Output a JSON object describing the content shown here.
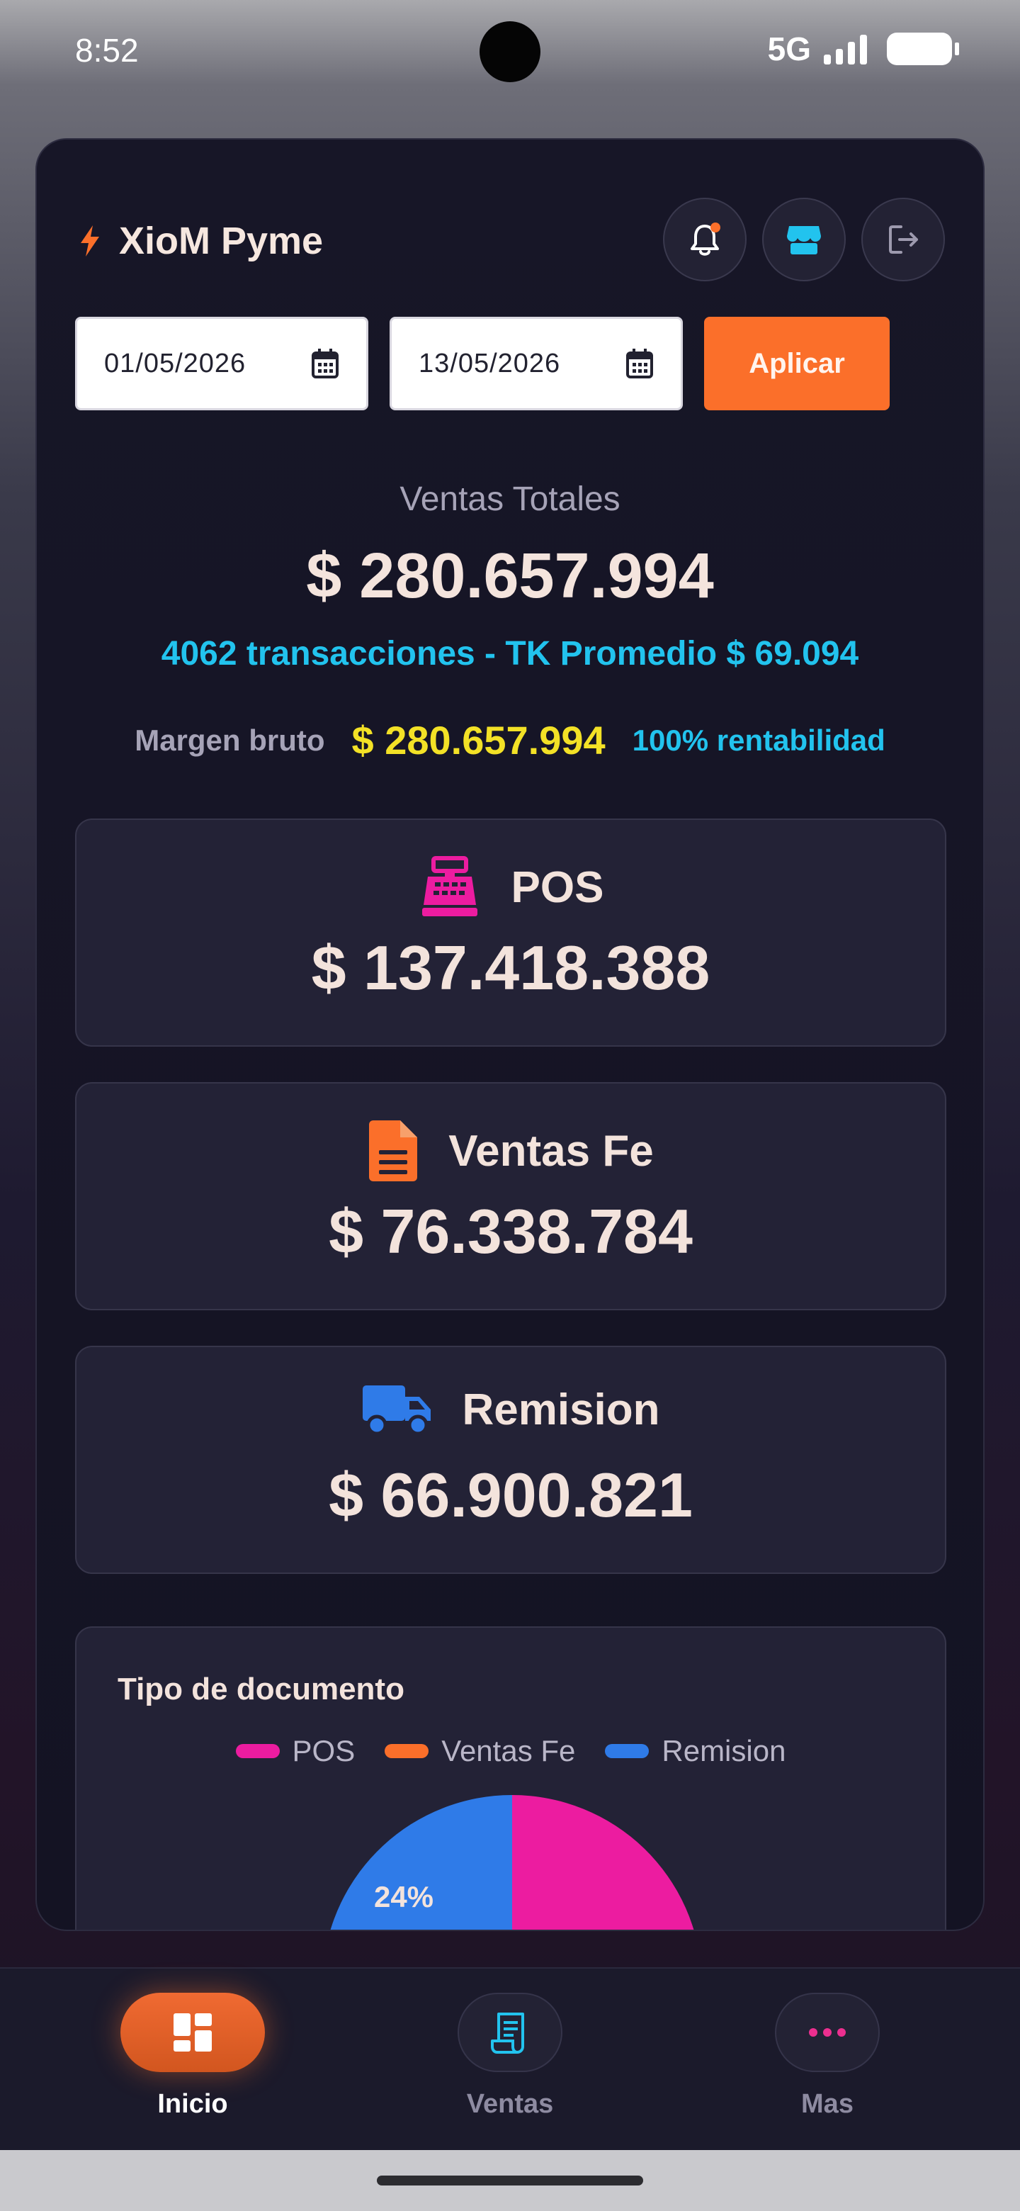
{
  "status": {
    "time": "8:52",
    "network": "5G"
  },
  "app": {
    "brand": "XioM Pyme"
  },
  "filters": {
    "date_from": "01/05/2026",
    "date_to": "13/05/2026",
    "apply_label": "Aplicar"
  },
  "totals": {
    "label": "Ventas Totales",
    "amount": "$ 280.657.994",
    "subtitle": "4062 transacciones - TK Promedio $ 69.094",
    "margin_label": "Margen bruto",
    "margin_amount": "$ 280.657.994",
    "margin_pct": "100% rentabilidad"
  },
  "kpis": [
    {
      "title": "POS",
      "amount": "$ 137.418.388",
      "icon": "cash-register-icon",
      "color": "#ec1ca0"
    },
    {
      "title": "Ventas Fe",
      "amount": "$ 76.338.784",
      "icon": "document-icon",
      "color": "#fb6f2a"
    },
    {
      "title": "Remision",
      "amount": "$ 66.900.821",
      "icon": "truck-icon",
      "color": "#2f7be8"
    }
  ],
  "chart_data": {
    "type": "pie",
    "title": "Tipo de documento",
    "categories": [
      "POS",
      "Ventas Fe",
      "Remision"
    ],
    "values": [
      137418388,
      76338784,
      66900821
    ],
    "colors": [
      "#ec1ca0",
      "#fb6f2a",
      "#2f7be8"
    ],
    "visible_labels": [
      "24%"
    ],
    "legend_position": "top"
  },
  "nav": {
    "items": [
      {
        "label": "Inicio",
        "icon": "dashboard-icon",
        "active": true
      },
      {
        "label": "Ventas",
        "icon": "receipt-icon",
        "active": false
      },
      {
        "label": "Mas",
        "icon": "more-dots-icon",
        "active": false
      }
    ]
  }
}
